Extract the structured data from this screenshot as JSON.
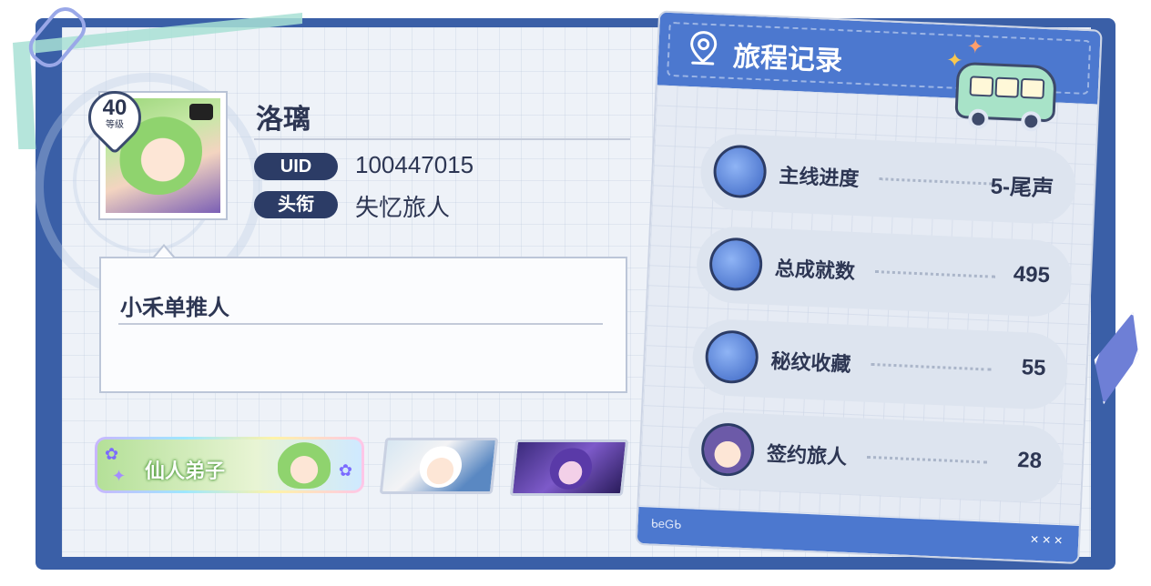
{
  "profile": {
    "name": "洛璃",
    "level": "40",
    "level_label": "等级",
    "uid_label": "UID",
    "uid": "100447015",
    "title_label": "头衔",
    "title": "失忆旅人",
    "signature": "小禾单推人"
  },
  "badges": {
    "main_label": "仙人弟子"
  },
  "journey": {
    "title": "旅程记录",
    "footer_brand": "ᑲeGᑲ",
    "footer_marks": "✕✕✕",
    "stats": [
      {
        "label": "主线进度",
        "value": "5-尾声",
        "icon": "compass-book-icon"
      },
      {
        "label": "总成就数",
        "value": "495",
        "icon": "trophy-book-icon"
      },
      {
        "label": "秘纹收藏",
        "value": "55",
        "icon": "music-disc-icon"
      },
      {
        "label": "签约旅人",
        "value": "28",
        "icon": "traveler-portrait-icon"
      }
    ]
  },
  "colors": {
    "frame": "#3a5fa7",
    "journey_header": "#4c78cf",
    "pill": "#2c3c66",
    "text": "#2d3653"
  }
}
